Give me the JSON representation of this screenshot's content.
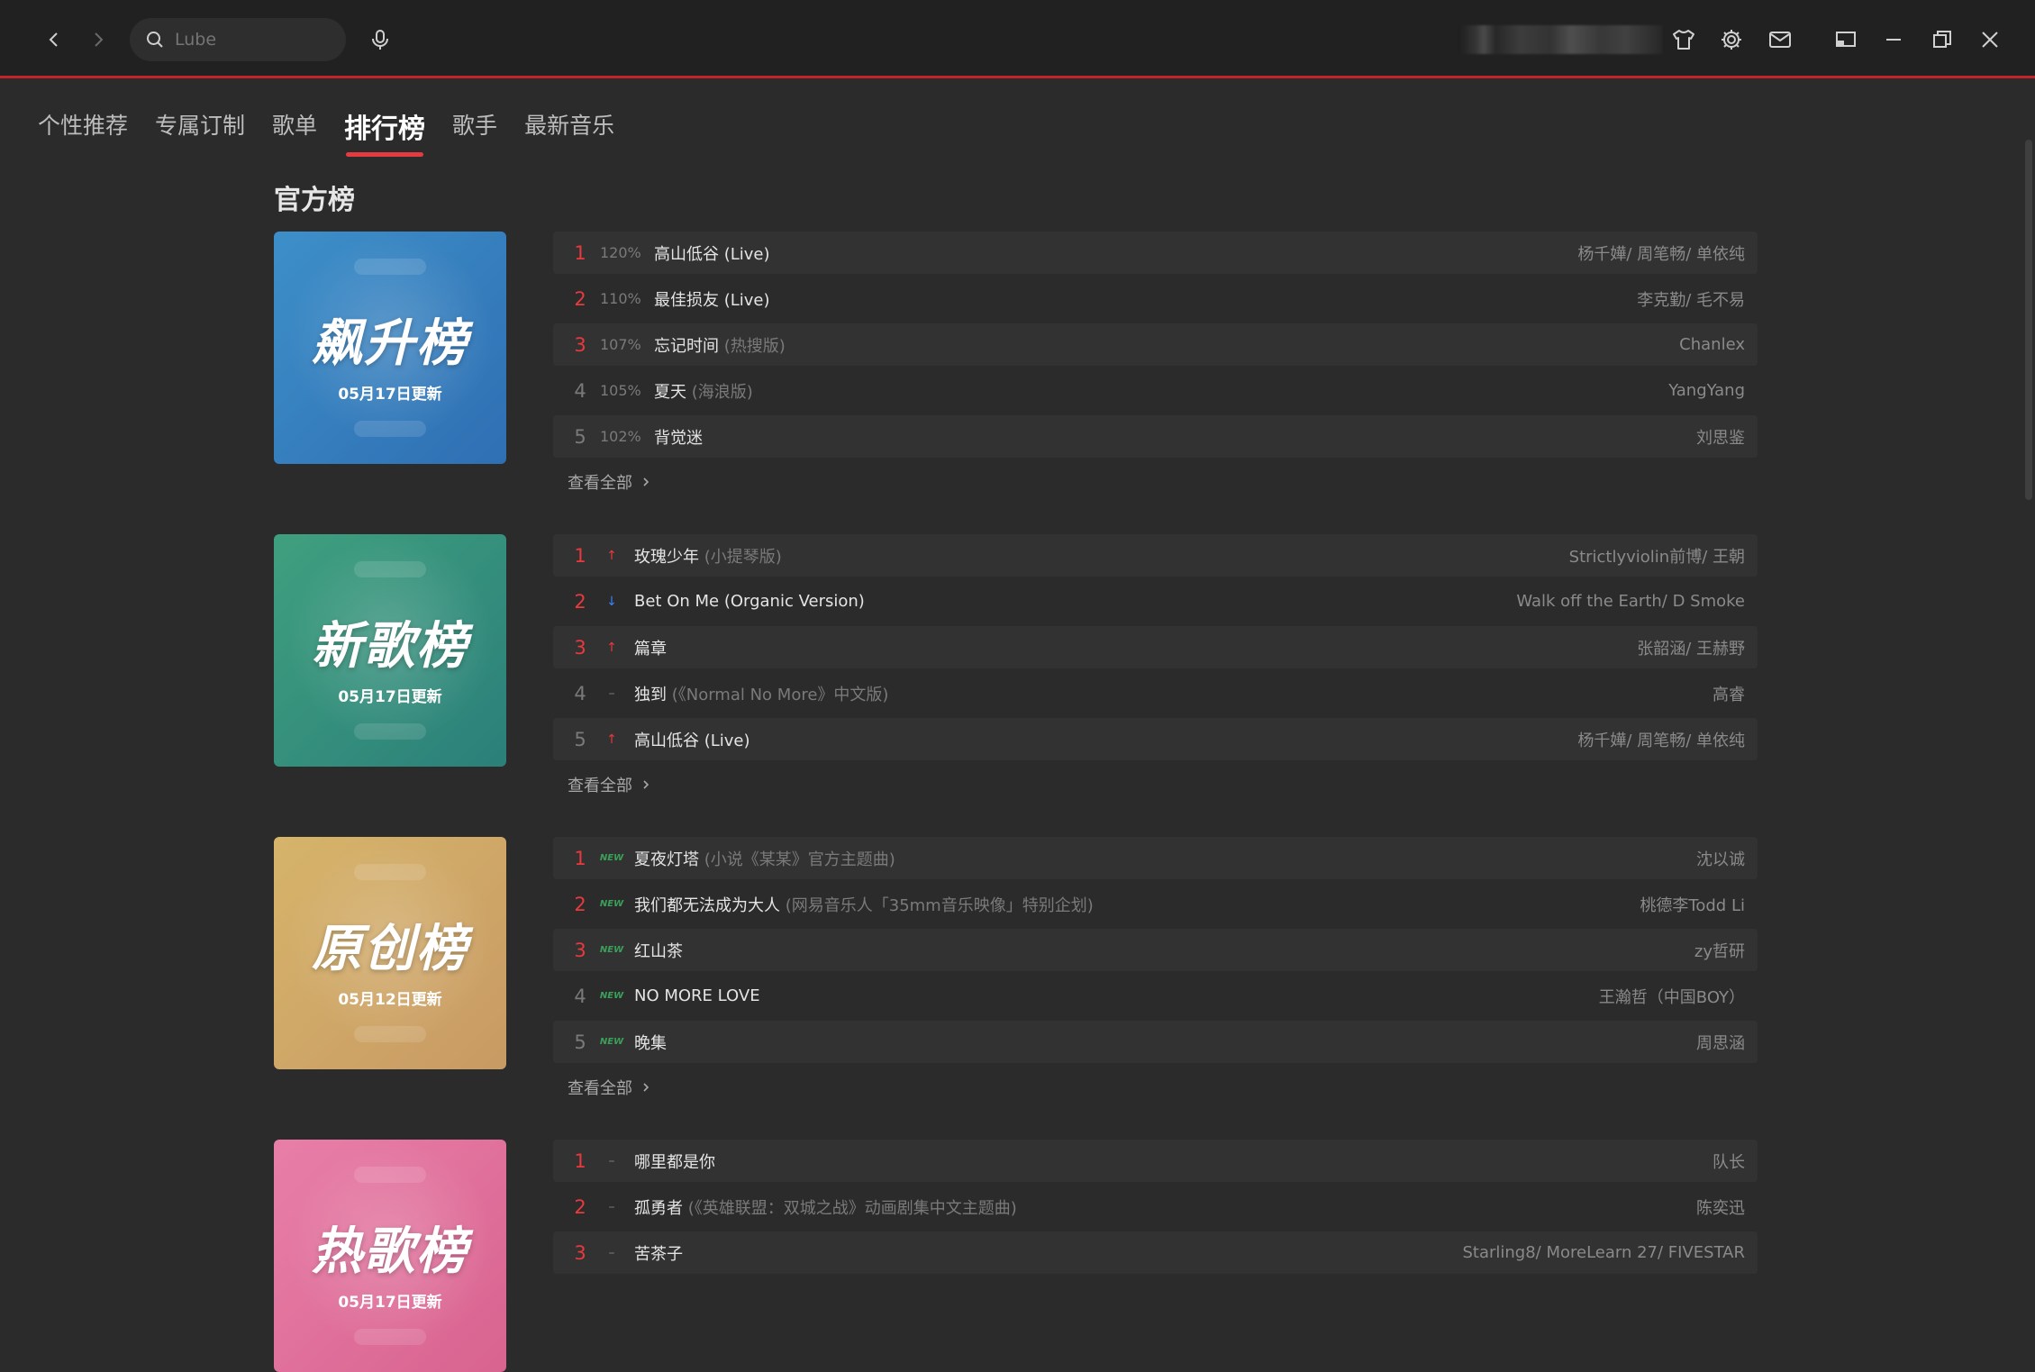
{
  "search": {
    "placeholder": "Lube"
  },
  "tabs": [
    {
      "label": "个性推荐",
      "active": false
    },
    {
      "label": "专属订制",
      "active": false
    },
    {
      "label": "歌单",
      "active": false
    },
    {
      "label": "排行榜",
      "active": true
    },
    {
      "label": "歌手",
      "active": false
    },
    {
      "label": "最新音乐",
      "active": false
    }
  ],
  "section_title": "官方榜",
  "view_all_label": "查看全部",
  "icons": {
    "back": "chevron-left-icon",
    "forward": "chevron-right-icon",
    "search": "search-icon",
    "mic": "microphone-icon",
    "skin": "shirt-icon",
    "settings": "gear-icon",
    "mail": "mail-icon",
    "mini": "mini-mode-icon",
    "minimize": "minimize-icon",
    "maximize": "restore-icon",
    "close": "close-icon"
  },
  "charts": [
    {
      "cover_title": "飙升榜",
      "cover_date": "05月17日更新",
      "cover_colors": [
        "#3d8fc9",
        "#2f6fb3"
      ],
      "rows": [
        {
          "rank": "1",
          "pct": "120%",
          "trend": "",
          "song": "高山低谷 (Live)",
          "sub": "",
          "artist": "杨千嬅/ 周笔畅/ 单依纯"
        },
        {
          "rank": "2",
          "pct": "110%",
          "trend": "",
          "song": "最佳损友 (Live)",
          "sub": "",
          "artist": "李克勤/ 毛不易"
        },
        {
          "rank": "3",
          "pct": "107%",
          "trend": "",
          "song": "忘记时间",
          "sub": "(热搜版)",
          "artist": "Chanlex"
        },
        {
          "rank": "4",
          "pct": "105%",
          "trend": "",
          "song": "夏天",
          "sub": "(海浪版)",
          "artist": "YangYang"
        },
        {
          "rank": "5",
          "pct": "102%",
          "trend": "",
          "song": "背觉迷",
          "sub": "",
          "artist": "刘思鉴"
        }
      ]
    },
    {
      "cover_title": "新歌榜",
      "cover_date": "05月17日更新",
      "cover_colors": [
        "#3fa07e",
        "#2b7f7a"
      ],
      "rows": [
        {
          "rank": "1",
          "pct": "",
          "trend": "up",
          "song": "玫瑰少年",
          "sub": "(小提琴版)",
          "artist": "Strictlyviolin前博/ 王朝"
        },
        {
          "rank": "2",
          "pct": "",
          "trend": "down",
          "song": "Bet On Me (Organic Version)",
          "sub": "",
          "artist": "Walk off the Earth/ D Smoke"
        },
        {
          "rank": "3",
          "pct": "",
          "trend": "up",
          "song": "篇章",
          "sub": "",
          "artist": "张韶涵/ 王赫野"
        },
        {
          "rank": "4",
          "pct": "",
          "trend": "same",
          "song": "独到",
          "sub": "(《Normal No More》中文版)",
          "artist": "高睿"
        },
        {
          "rank": "5",
          "pct": "",
          "trend": "up",
          "song": "高山低谷 (Live)",
          "sub": "",
          "artist": "杨千嬅/ 周笔畅/ 单依纯"
        }
      ]
    },
    {
      "cover_title": "原创榜",
      "cover_date": "05月12日更新",
      "cover_colors": [
        "#d6b46a",
        "#c89a64"
      ],
      "rows": [
        {
          "rank": "1",
          "pct": "",
          "trend": "new",
          "song": "夏夜灯塔",
          "sub": "(小说《某某》官方主题曲)",
          "artist": "沈以诚"
        },
        {
          "rank": "2",
          "pct": "",
          "trend": "new",
          "song": "我们都无法成为大人",
          "sub": "(网易音乐人「35mm音乐映像」特别企划)",
          "artist": "桃德李Todd Li"
        },
        {
          "rank": "3",
          "pct": "",
          "trend": "new",
          "song": "红山茶",
          "sub": "",
          "artist": "zy哲研"
        },
        {
          "rank": "4",
          "pct": "",
          "trend": "new",
          "song": "NO MORE LOVE",
          "sub": "",
          "artist": "王瀚哲（中国BOY）"
        },
        {
          "rank": "5",
          "pct": "",
          "trend": "new",
          "song": "晚集",
          "sub": "",
          "artist": "周思涵"
        }
      ]
    },
    {
      "cover_title": "热歌榜",
      "cover_date": "05月17日更新",
      "cover_colors": [
        "#e87fa8",
        "#d8638f"
      ],
      "rows": [
        {
          "rank": "1",
          "pct": "",
          "trend": "same",
          "song": "哪里都是你",
          "sub": "",
          "artist": "队长"
        },
        {
          "rank": "2",
          "pct": "",
          "trend": "same",
          "song": "孤勇者",
          "sub": "(《英雄联盟：双城之战》动画剧集中文主题曲)",
          "artist": "陈奕迅"
        },
        {
          "rank": "3",
          "pct": "",
          "trend": "same",
          "song": "苦茶子",
          "sub": "",
          "artist": "Starling8/ MoreLearn 27/ FIVESTAR"
        }
      ]
    }
  ],
  "trend_glyphs": {
    "up": "↑",
    "down": "↓",
    "same": "–",
    "new": "NEW"
  }
}
